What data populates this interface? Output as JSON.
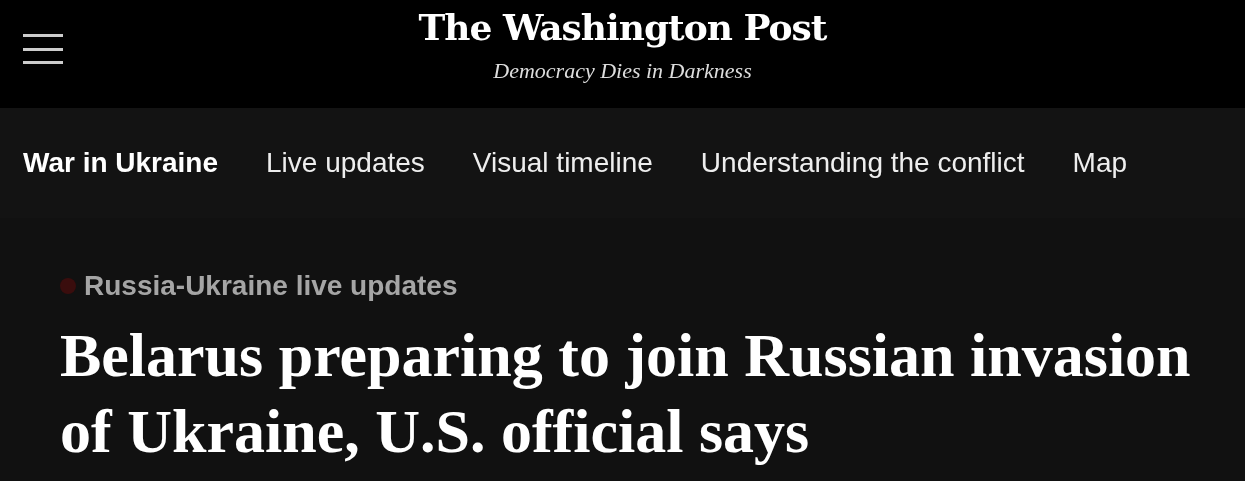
{
  "masthead": {
    "logo": "The Washington Post",
    "tagline": "Democracy Dies in Darkness"
  },
  "nav": [
    {
      "label": "War in Ukraine",
      "selected": true
    },
    {
      "label": "Live updates",
      "selected": false
    },
    {
      "label": "Visual timeline",
      "selected": false
    },
    {
      "label": "Understanding the conflict",
      "selected": false
    },
    {
      "label": "Map",
      "selected": false
    }
  ],
  "article": {
    "kicker": "Russia-Ukraine live updates",
    "headline": "Belarus preparing to join Russian invasion of Ukraine, U.S. official says"
  }
}
